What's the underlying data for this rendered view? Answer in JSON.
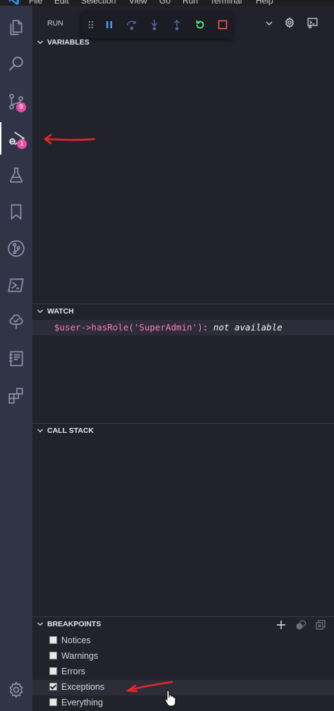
{
  "menu": {
    "items": [
      "File",
      "Edit",
      "Selection",
      "View",
      "Go",
      "Run",
      "Terminal",
      "Help"
    ]
  },
  "activity_bar": {
    "source_control_badge": "9",
    "debug_badge": "1"
  },
  "run_panel": {
    "title": "RUN"
  },
  "sections": {
    "variables": "VARIABLES",
    "watch": "WATCH",
    "call_stack": "CALL STACK",
    "breakpoints": "BREAKPOINTS"
  },
  "watch": {
    "items": [
      {
        "expression": "$user->hasRole('SuperAdmin')",
        "separator": ":",
        "value": "not available"
      }
    ]
  },
  "breakpoints": {
    "items": [
      {
        "label": "Notices",
        "checked": false
      },
      {
        "label": "Warnings",
        "checked": false
      },
      {
        "label": "Errors",
        "checked": false
      },
      {
        "label": "Exceptions",
        "checked": true
      },
      {
        "label": "Everything",
        "checked": false
      }
    ]
  },
  "colors": {
    "activity_bar": "#2f3446",
    "sidebar": "#21222c",
    "badge": "#e94ea3",
    "annotation_red": "#e8262b",
    "watch_expression": "#ff79c6",
    "continue_green": "#50fa7b",
    "stop_red": "#ff5555",
    "pause_blue": "#4fa3ff"
  }
}
